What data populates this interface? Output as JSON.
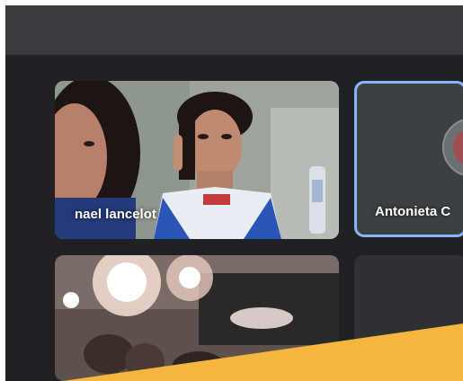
{
  "participants": [
    {
      "name": "nael lancelot"
    },
    {
      "name": "Antonieta C"
    },
    {
      "name": ""
    },
    {
      "name": ""
    }
  ],
  "colors": {
    "background": "#202124",
    "topbar": "#3a3b3e",
    "active_speaker_border": "#8ab4f8",
    "banner": "#f5b640"
  },
  "active_speaker_index": 1
}
